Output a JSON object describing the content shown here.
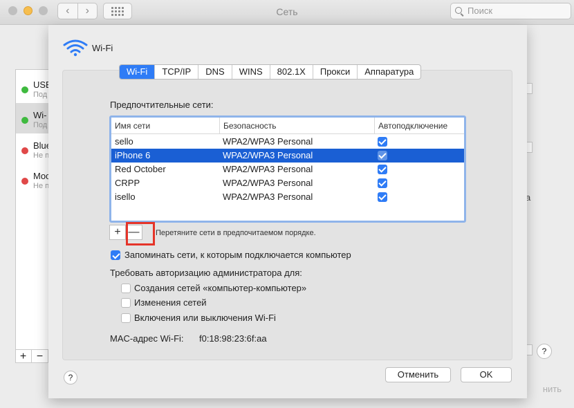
{
  "window": {
    "title": "Сеть",
    "search_placeholder": "Поиск",
    "back_glyph": "‹",
    "forward_glyph": "›"
  },
  "background": {
    "services": [
      {
        "name": "USB",
        "status": "Под",
        "dot_color": "#3fba3f"
      },
      {
        "name": "Wi-",
        "status": "Под",
        "dot_color": "#3fba3f"
      },
      {
        "name": "Blue",
        "status": "Не п",
        "dot_color": "#e04848"
      },
      {
        "name": "Moc",
        "status": "Не п",
        "dot_color": "#e04848"
      }
    ],
    "add_label": "+",
    "remove_label": "−",
    "right_fragment": "а",
    "help_label": "?",
    "apply_fragment": "нить"
  },
  "sheet": {
    "title": "Wi-Fi",
    "tabs": [
      {
        "label": "Wi-Fi",
        "active": true
      },
      {
        "label": "TCP/IP",
        "active": false
      },
      {
        "label": "DNS",
        "active": false
      },
      {
        "label": "WINS",
        "active": false
      },
      {
        "label": "802.1X",
        "active": false
      },
      {
        "label": "Прокси",
        "active": false
      },
      {
        "label": "Аппаратура",
        "active": false
      }
    ],
    "preferred_label": "Предпочтительные сети:",
    "columns": {
      "name": "Имя сети",
      "security": "Безопасность",
      "auto": "Автоподключение"
    },
    "networks": [
      {
        "name": "sello",
        "security": "WPA2/WPA3 Personal",
        "auto": true,
        "selected": false
      },
      {
        "name": "iPhone 6",
        "security": "WPA2/WPA3 Personal",
        "auto": true,
        "selected": true
      },
      {
        "name": "Red October",
        "security": "WPA2/WPA3 Personal",
        "auto": true,
        "selected": false
      },
      {
        "name": "CRPP",
        "security": "WPA2/WPA3 Personal",
        "auto": true,
        "selected": false
      },
      {
        "name": "isello",
        "security": "WPA2/WPA3 Personal",
        "auto": true,
        "selected": false
      }
    ],
    "add_label": "+",
    "remove_label": "—",
    "drag_hint": "Перетяните сети в предпочитаемом порядке.",
    "remember_label": "Запоминать сети, к которым подключается компьютер",
    "remember_checked": true,
    "require_admin_label": "Требовать авторизацию администратора для:",
    "admin_options": [
      {
        "label": "Создания сетей «компьютер-компьютер»",
        "checked": false
      },
      {
        "label": "Изменения сетей",
        "checked": false
      },
      {
        "label": "Включения или выключения Wi-Fi",
        "checked": false
      }
    ],
    "mac_label": "MAC-адрес Wi-Fi:",
    "mac_value": "f0:18:98:23:6f:aa",
    "help_label": "?",
    "cancel_label": "Отменить",
    "ok_label": "OK"
  },
  "colors": {
    "accent": "#2f7cf6",
    "selection": "#1a5fd4",
    "highlight_box": "#e53429"
  }
}
